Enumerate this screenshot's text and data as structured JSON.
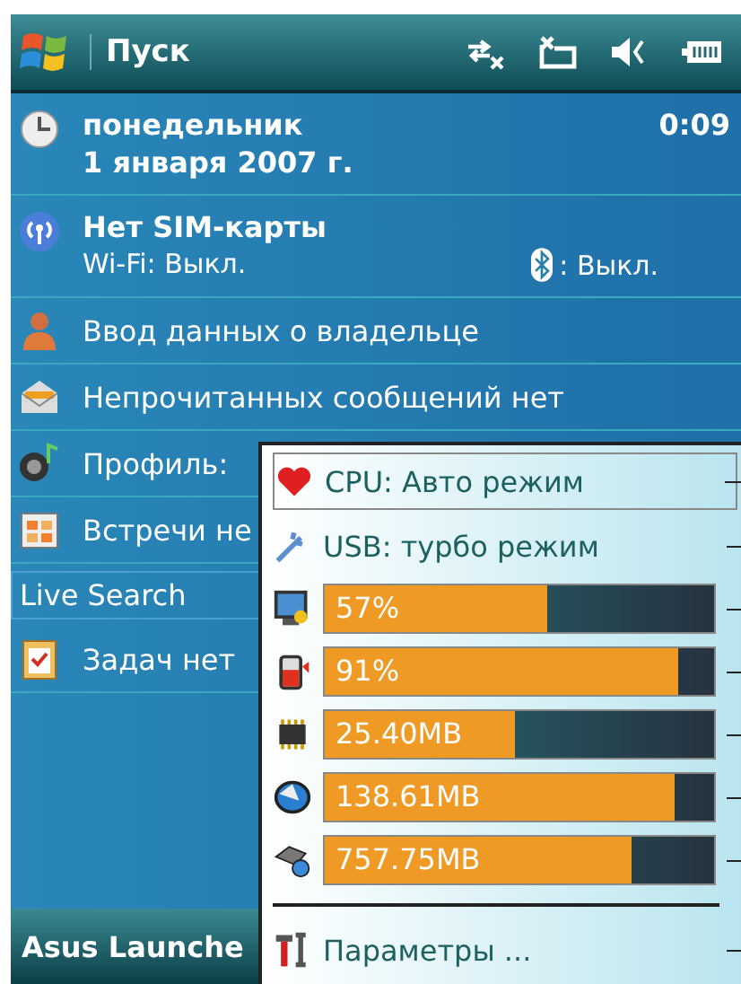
{
  "top_bar": {
    "title": "Пуск"
  },
  "today": [
    {
      "kind": "date",
      "line1": "понедельник",
      "line2": "1 января 2007 г.",
      "time": "0:09"
    },
    {
      "kind": "wireless",
      "line1": "Нет SIM-карты",
      "wifi": "Wi-Fi: Выкл.",
      "bluetooth": ": Выкл."
    },
    {
      "kind": "owner",
      "line1": "Ввод данных о владельце"
    },
    {
      "kind": "messages",
      "line1": "Непрочитанных сообщений нет"
    },
    {
      "kind": "profile",
      "line1": "Профиль:"
    },
    {
      "kind": "calendar",
      "line1": "Встречи не"
    },
    {
      "kind": "search",
      "line1": "Live Search"
    },
    {
      "kind": "tasks",
      "line1": "Задач нет"
    }
  ],
  "bottom_bar": {
    "label": "Asus Launche"
  },
  "popup": {
    "items": [
      {
        "kind": "toggle",
        "label": "CPU: Авто режим",
        "selected": true
      },
      {
        "kind": "toggle",
        "label": "USB: турбо режим",
        "selected": false
      },
      {
        "kind": "meter",
        "label": "57%",
        "level": 0.57
      },
      {
        "kind": "meter",
        "label": "91%",
        "level": 0.91
      },
      {
        "kind": "meter",
        "label": "25.40MB",
        "level": 0.49
      },
      {
        "kind": "meter",
        "label": "138.61MB",
        "level": 0.9
      },
      {
        "kind": "meter",
        "label": "757.75MB",
        "level": 0.79
      },
      {
        "kind": "separator"
      },
      {
        "kind": "link",
        "label": "Параметры ..."
      }
    ]
  }
}
